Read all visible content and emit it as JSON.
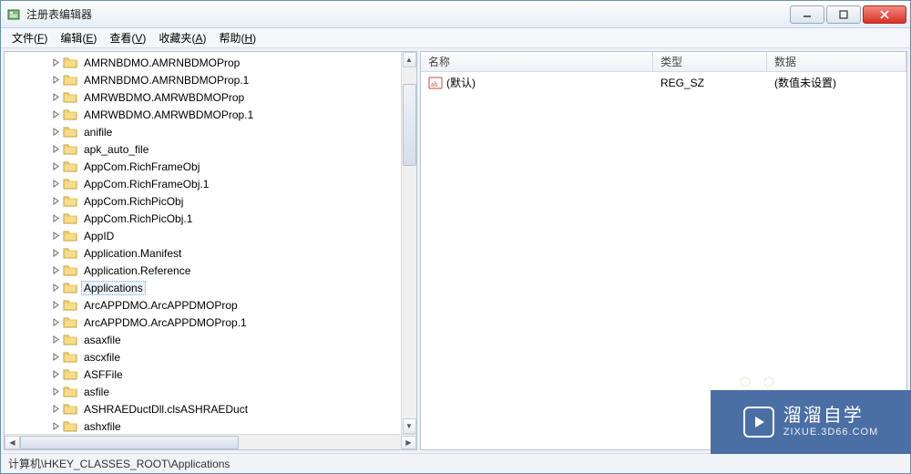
{
  "title": "注册表编辑器",
  "menus": [
    {
      "label": "文件",
      "accel": "F"
    },
    {
      "label": "编辑",
      "accel": "E"
    },
    {
      "label": "查看",
      "accel": "V"
    },
    {
      "label": "收藏夹",
      "accel": "A"
    },
    {
      "label": "帮助",
      "accel": "H"
    }
  ],
  "tree": {
    "items": [
      {
        "label": "AMRNBDMO.AMRNBDMOProp"
      },
      {
        "label": "AMRNBDMO.AMRNBDMOProp.1"
      },
      {
        "label": "AMRWBDMO.AMRWBDMOProp"
      },
      {
        "label": "AMRWBDMO.AMRWBDMOProp.1"
      },
      {
        "label": "anifile"
      },
      {
        "label": "apk_auto_file"
      },
      {
        "label": "AppCom.RichFrameObj"
      },
      {
        "label": "AppCom.RichFrameObj.1"
      },
      {
        "label": "AppCom.RichPicObj"
      },
      {
        "label": "AppCom.RichPicObj.1"
      },
      {
        "label": "AppID"
      },
      {
        "label": "Application.Manifest"
      },
      {
        "label": "Application.Reference"
      },
      {
        "label": "Applications",
        "selected": true
      },
      {
        "label": "ArcAPPDMO.ArcAPPDMOProp"
      },
      {
        "label": "ArcAPPDMO.ArcAPPDMOProp.1"
      },
      {
        "label": "asaxfile"
      },
      {
        "label": "ascxfile"
      },
      {
        "label": "ASFFile"
      },
      {
        "label": "asfile"
      },
      {
        "label": "ASHRAEDuctDll.clsASHRAEDuct"
      },
      {
        "label": "ashxfile"
      }
    ]
  },
  "list": {
    "headers": {
      "name": "名称",
      "type": "类型",
      "data": "数据"
    },
    "rows": [
      {
        "name": "(默认)",
        "type": "REG_SZ",
        "data": "(数值未设置)"
      }
    ]
  },
  "statusbar": "计算机\\HKEY_CLASSES_ROOT\\Applications",
  "watermark": {
    "title": "溜溜自学",
    "subtitle": "ZIXUE.3D66.COM"
  }
}
